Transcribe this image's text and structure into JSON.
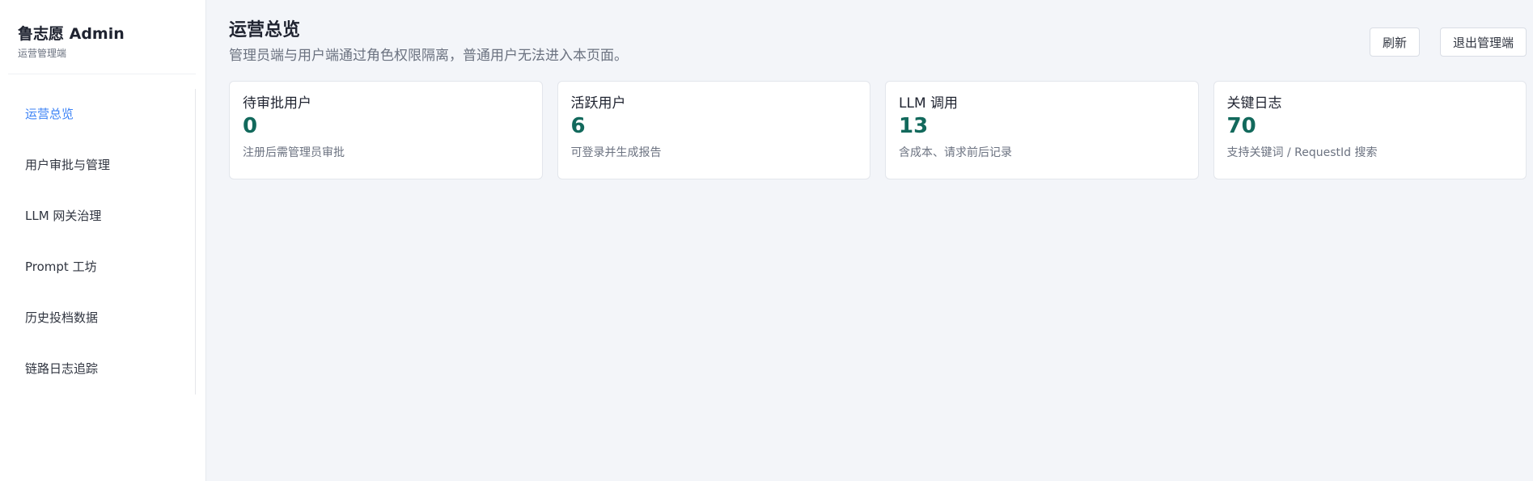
{
  "sidebar": {
    "brand_title": "鲁志愿 Admin",
    "brand_subtitle": "运营管理端",
    "items": [
      {
        "label": "运营总览",
        "active": true
      },
      {
        "label": "用户审批与管理",
        "active": false
      },
      {
        "label": "LLM 网关治理",
        "active": false
      },
      {
        "label": "Prompt 工坊",
        "active": false
      },
      {
        "label": "历史投档数据",
        "active": false
      },
      {
        "label": "链路日志追踪",
        "active": false
      }
    ]
  },
  "header": {
    "title": "运营总览",
    "description": "管理员端与用户端通过角色权限隔离，普通用户无法进入本页面。",
    "refresh_label": "刷新",
    "logout_label": "退出管理端"
  },
  "cards": [
    {
      "title": "待审批用户",
      "value": "0",
      "desc": "注册后需管理员审批"
    },
    {
      "title": "活跃用户",
      "value": "6",
      "desc": "可登录并生成报告"
    },
    {
      "title": "LLM 调用",
      "value": "13",
      "desc": "含成本、请求前后记录"
    },
    {
      "title": "关键日志",
      "value": "70",
      "desc": "支持关键词 / RequestId 搜索"
    }
  ],
  "colors": {
    "accent": "#3b82f6",
    "metric": "#12695c",
    "background": "#f3f5f9"
  }
}
